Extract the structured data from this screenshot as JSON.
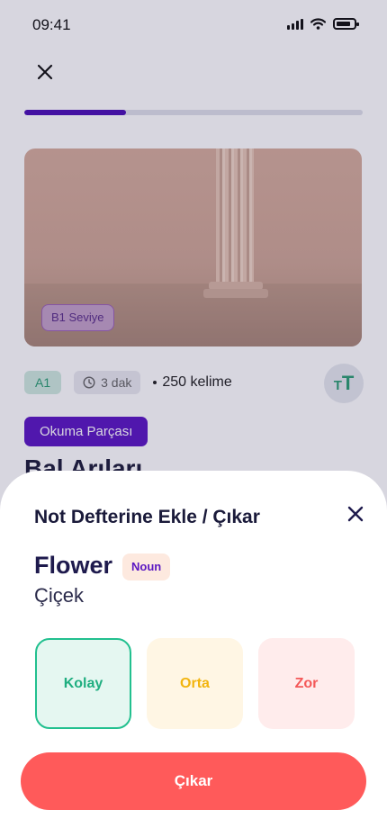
{
  "status": {
    "time": "09:41"
  },
  "lesson": {
    "progress": 0.3,
    "image_badge": "B1 Seviye",
    "level": "A1",
    "duration": "3 dak",
    "word_count": "250 kelime",
    "tag": "Okuma Parçası",
    "title": "Bal Arıları"
  },
  "sheet": {
    "title": "Not Defterine Ekle / Çıkar",
    "word": "Flower",
    "part_of_speech": "Noun",
    "translation": "Çiçek",
    "difficulty": [
      {
        "label": "Kolay",
        "selected": true,
        "color": "#1fae80"
      },
      {
        "label": "Orta",
        "selected": false,
        "color": "#f2b40e"
      },
      {
        "label": "Zor",
        "selected": false,
        "color": "#f45858"
      }
    ],
    "action_label": "Çıkar"
  },
  "colors": {
    "accent": "#5b17c2",
    "danger": "#ff5a5a",
    "success": "#22c08f"
  },
  "icons": [
    "close-icon",
    "clock-icon",
    "text-size-icon",
    "signal-icon",
    "wifi-icon",
    "battery-icon"
  ]
}
